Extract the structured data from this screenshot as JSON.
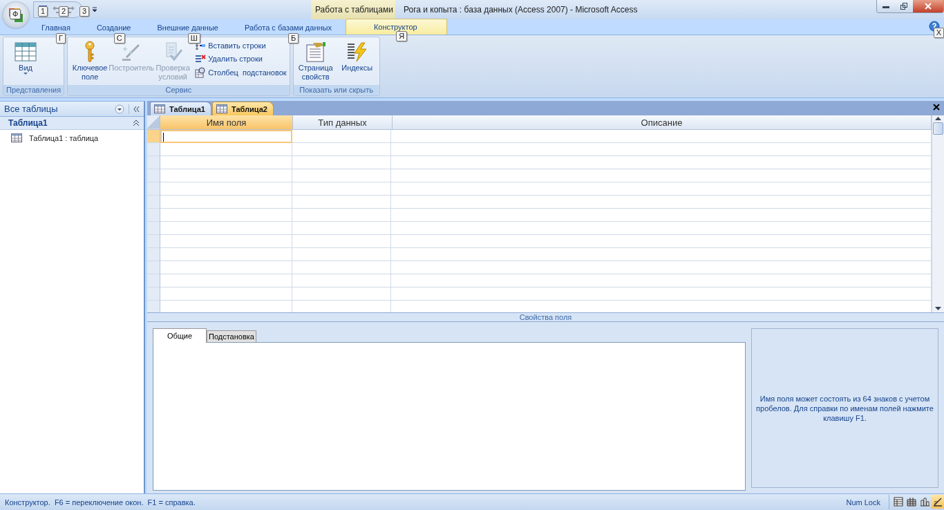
{
  "title_bar": {
    "office_keytip": "Ф",
    "qat_keytips": [
      "1",
      "2",
      "3"
    ],
    "context_label": "Работа с таблицами",
    "title": "Рога и копыта : база данных (Access 2007)  -  Microsoft Access",
    "help_keytip": "Х"
  },
  "ribbon": {
    "tabs": [
      {
        "label": "Главная",
        "selected": false,
        "keytip": "Г"
      },
      {
        "label": "Создание",
        "selected": false,
        "keytip": "С"
      },
      {
        "label": "Внешние данные",
        "selected": false,
        "keytip": "Ш"
      },
      {
        "label": "Работа с базами данных",
        "selected": false,
        "keytip": "Б"
      },
      {
        "label": "Конструктор",
        "selected": true,
        "keytip": "Я"
      }
    ],
    "groups": [
      {
        "label": "Представления",
        "large": [
          {
            "kind": "view",
            "label": "Вид",
            "disabled": false,
            "dropdown": true
          }
        ]
      },
      {
        "label": "Сервис",
        "large": [
          {
            "kind": "key",
            "label": "Ключевое поле",
            "disabled": false,
            "dropdown": false
          },
          {
            "kind": "builder",
            "label": "Построитель",
            "disabled": true,
            "dropdown": false
          },
          {
            "kind": "check",
            "label": "Проверка условий",
            "disabled": true,
            "dropdown": false
          }
        ],
        "small": [
          {
            "kind": "insert",
            "label": "Вставить строки"
          },
          {
            "kind": "delete",
            "label": "Удалить строки"
          },
          {
            "kind": "lookup",
            "label": "Столбец  подстановок"
          }
        ]
      },
      {
        "label": "Показать или скрыть",
        "large": [
          {
            "kind": "sheet",
            "label": "Страница свойств",
            "disabled": false,
            "dropdown": false
          },
          {
            "kind": "index",
            "label": "Индексы",
            "disabled": false,
            "dropdown": false
          }
        ]
      }
    ]
  },
  "nav_pane": {
    "header": "Все таблицы",
    "groups": [
      {
        "label": "Таблица1",
        "items": [
          "Таблица1 : таблица"
        ]
      }
    ]
  },
  "document_tabs": [
    {
      "label": "Таблица1",
      "selected": false
    },
    {
      "label": "Таблица2",
      "selected": true
    }
  ],
  "design_grid": {
    "columns": [
      {
        "label": "Имя поля",
        "selected": true
      },
      {
        "label": "Тип данных",
        "selected": false
      },
      {
        "label": "Описание",
        "selected": false
      }
    ],
    "rows": [
      {
        "selected": true
      },
      {
        "selected": false
      },
      {
        "selected": false
      },
      {
        "selected": false
      },
      {
        "selected": false
      },
      {
        "selected": false
      },
      {
        "selected": false
      },
      {
        "selected": false
      },
      {
        "selected": false
      },
      {
        "selected": false
      },
      {
        "selected": false
      },
      {
        "selected": false
      },
      {
        "selected": false
      },
      {
        "selected": false
      }
    ]
  },
  "field_properties": {
    "title": "Свойства поля",
    "tabs": [
      {
        "label": "Общие",
        "selected": true
      },
      {
        "label": "Подстановка",
        "selected": false
      }
    ],
    "help": "Имя поля может состоять из 64 знаков с учетом пробелов.  Для справки по именам полей нажмите клавишу F1."
  },
  "status_bar": {
    "message": "Конструктор.  F6 = переключение окон.  F1 = справка.",
    "indicator": "Num Lock",
    "views": [
      {
        "kind": "datasheet",
        "selected": false
      },
      {
        "kind": "pivot-table",
        "selected": false
      },
      {
        "kind": "pivot-chart",
        "selected": false
      },
      {
        "kind": "design",
        "selected": true
      }
    ]
  }
}
